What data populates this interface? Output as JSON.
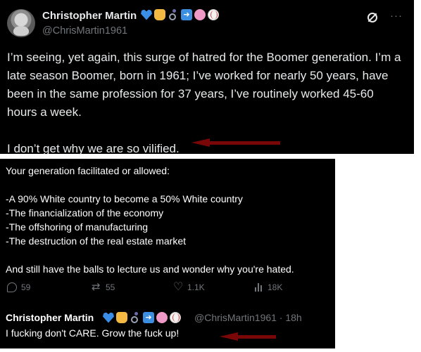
{
  "tweet": {
    "display_name": "Christopher Martin",
    "handle": "@ChrisMartin1961",
    "name_emojis": [
      "blue-heart",
      "rock-on-hand",
      "wheelchair",
      "right-arrow",
      "cherry-blossom",
      "baseball"
    ],
    "paragraphs": [
      "I’m seeing, yet again, this surge of hatred for the Boomer generation.  I’m a late season Boomer, born in 1961; I’ve worked for nearly 50 years, have been in the same profession for 37 years, I’ve routinely worked 45-60 hours a week.",
      "I don’t get why we are so vilified."
    ],
    "more_label": "···"
  },
  "reply_tweet": {
    "lines_top": [
      "Your generation facilitated or allowed:"
    ],
    "list": [
      "-A 90% White country to become a 50% White country",
      "-The financialization of the economy",
      "-The offshoring of manufacturing",
      "-The destruction of the real estate market"
    ],
    "closing": "And still have the balls to lecture us and wonder why you're hated.",
    "stats": {
      "replies": "59",
      "reposts": "55",
      "likes": "1.1K",
      "views": "18K"
    }
  },
  "response": {
    "display_name": "Christopher Martin",
    "handle_time": "@ChrisMartin1961 · 18h",
    "text": "I fucking don't CARE.  Grow the fuck up!"
  },
  "colors": {
    "annotation_arrow": "#7a0707",
    "background": "#000000",
    "secondary_text": "#71767b"
  }
}
